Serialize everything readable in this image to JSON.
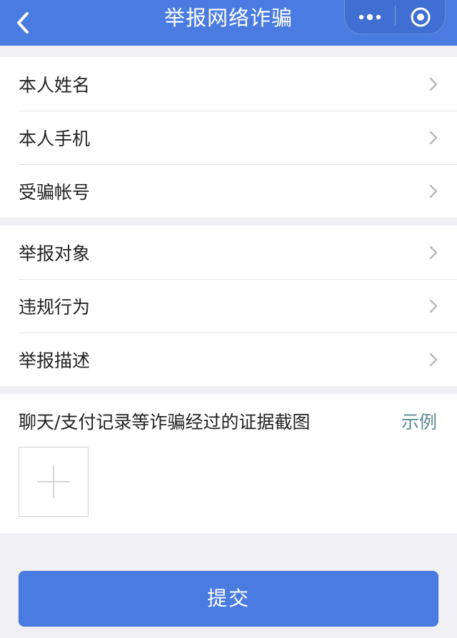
{
  "nav": {
    "title": "举报网络诈骗",
    "back_icon": "chevron-left-icon",
    "more_icon": "more-dots-icon",
    "close_icon": "target-close-icon"
  },
  "personal": {
    "items": [
      {
        "label": "本人姓名"
      },
      {
        "label": "本人手机"
      },
      {
        "label": "受骗帐号"
      }
    ]
  },
  "report": {
    "items": [
      {
        "label": "举报对象"
      },
      {
        "label": "违规行为"
      },
      {
        "label": "举报描述"
      }
    ]
  },
  "evidence": {
    "title": "聊天/支付记录等诈骗经过的证据截图",
    "example_link": "示例",
    "add_icon": "plus-icon"
  },
  "submit": {
    "label": "提交"
  },
  "colors": {
    "brand": "#4a7be0",
    "background": "#efeff4",
    "link": "#5a8a90"
  }
}
